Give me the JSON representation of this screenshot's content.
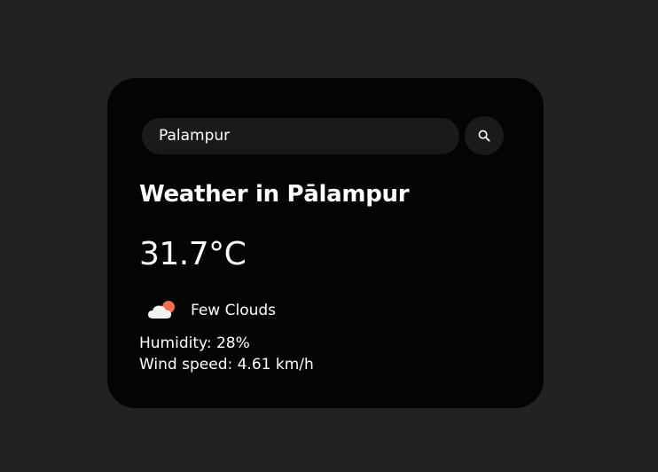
{
  "search": {
    "value": "Palampur",
    "placeholder": "Search"
  },
  "weather": {
    "title": "Weather in Pālampur",
    "temperature": "31.7°C",
    "description": "Few Clouds",
    "humidity": "Humidity: 28%",
    "wind": "Wind speed: 4.61 km/h",
    "icon": "few-clouds-day-icon"
  },
  "colors": {
    "background": "#222222",
    "card": "#040404",
    "input": "#1a1a1a",
    "text": "#ffffff",
    "sun": "#ee6e4d"
  }
}
